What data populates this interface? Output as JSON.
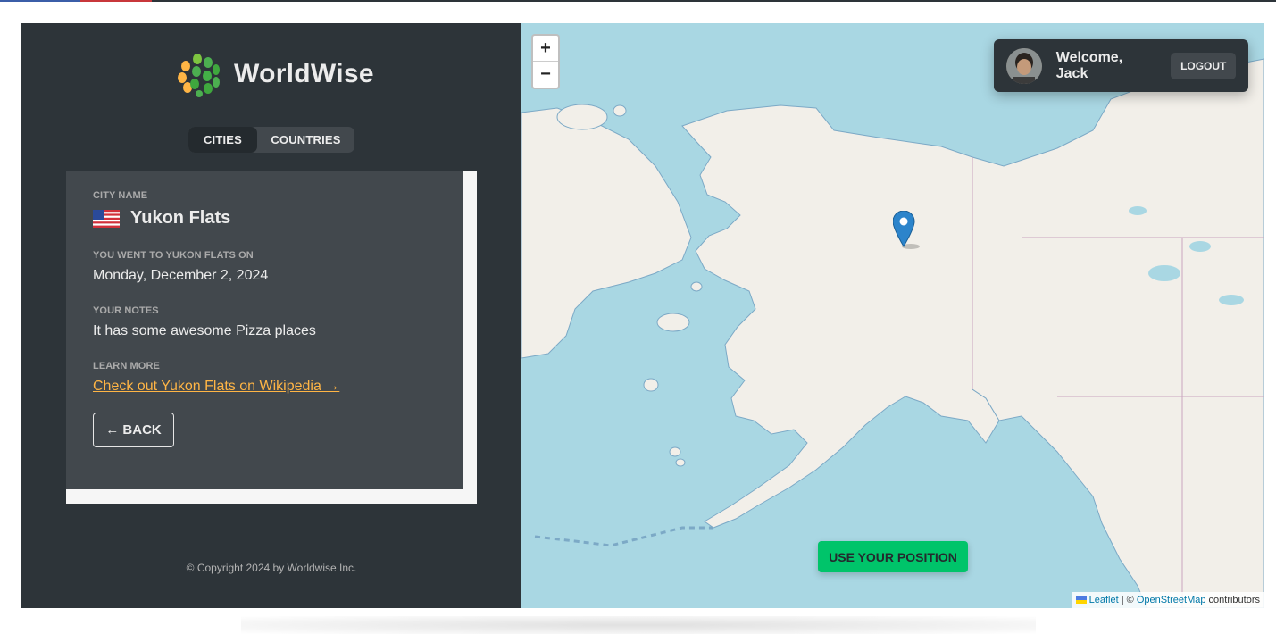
{
  "brand": {
    "name": "WorldWise"
  },
  "nav": {
    "tabs": [
      {
        "label": "CITIES",
        "active": true
      },
      {
        "label": "COUNTRIES",
        "active": false
      }
    ]
  },
  "city": {
    "name_label": "CITY NAME",
    "flag_icon": "us-flag-icon",
    "name": "Yukon Flats",
    "date_label": "YOU WENT TO YUKON FLATS ON",
    "date": "Monday, December 2, 2024",
    "notes_label": "YOUR NOTES",
    "notes": "It has some awesome Pizza places",
    "learn_label": "LEARN MORE",
    "learn_link": "Check out Yukon Flats on Wikipedia →",
    "back_label": "← BACK"
  },
  "footer": {
    "copyright": "© Copyright 2024 by Worldwise Inc."
  },
  "map": {
    "zoom_in": "+",
    "zoom_out": "−",
    "use_position": "USE YOUR POSITION",
    "attribution": {
      "leaflet": "Leaflet",
      "separator": " | © ",
      "osm": "OpenStreetMap",
      "suffix": " contributors"
    }
  },
  "user": {
    "welcome": "Welcome, Jack",
    "logout": "LOGOUT"
  },
  "colors": {
    "sidebar": "#2d3439",
    "card": "#42484d",
    "accent_green": "#00c46a",
    "link_orange": "#ffb545",
    "water": "#a9d7e3",
    "land": "#f2efe9"
  }
}
